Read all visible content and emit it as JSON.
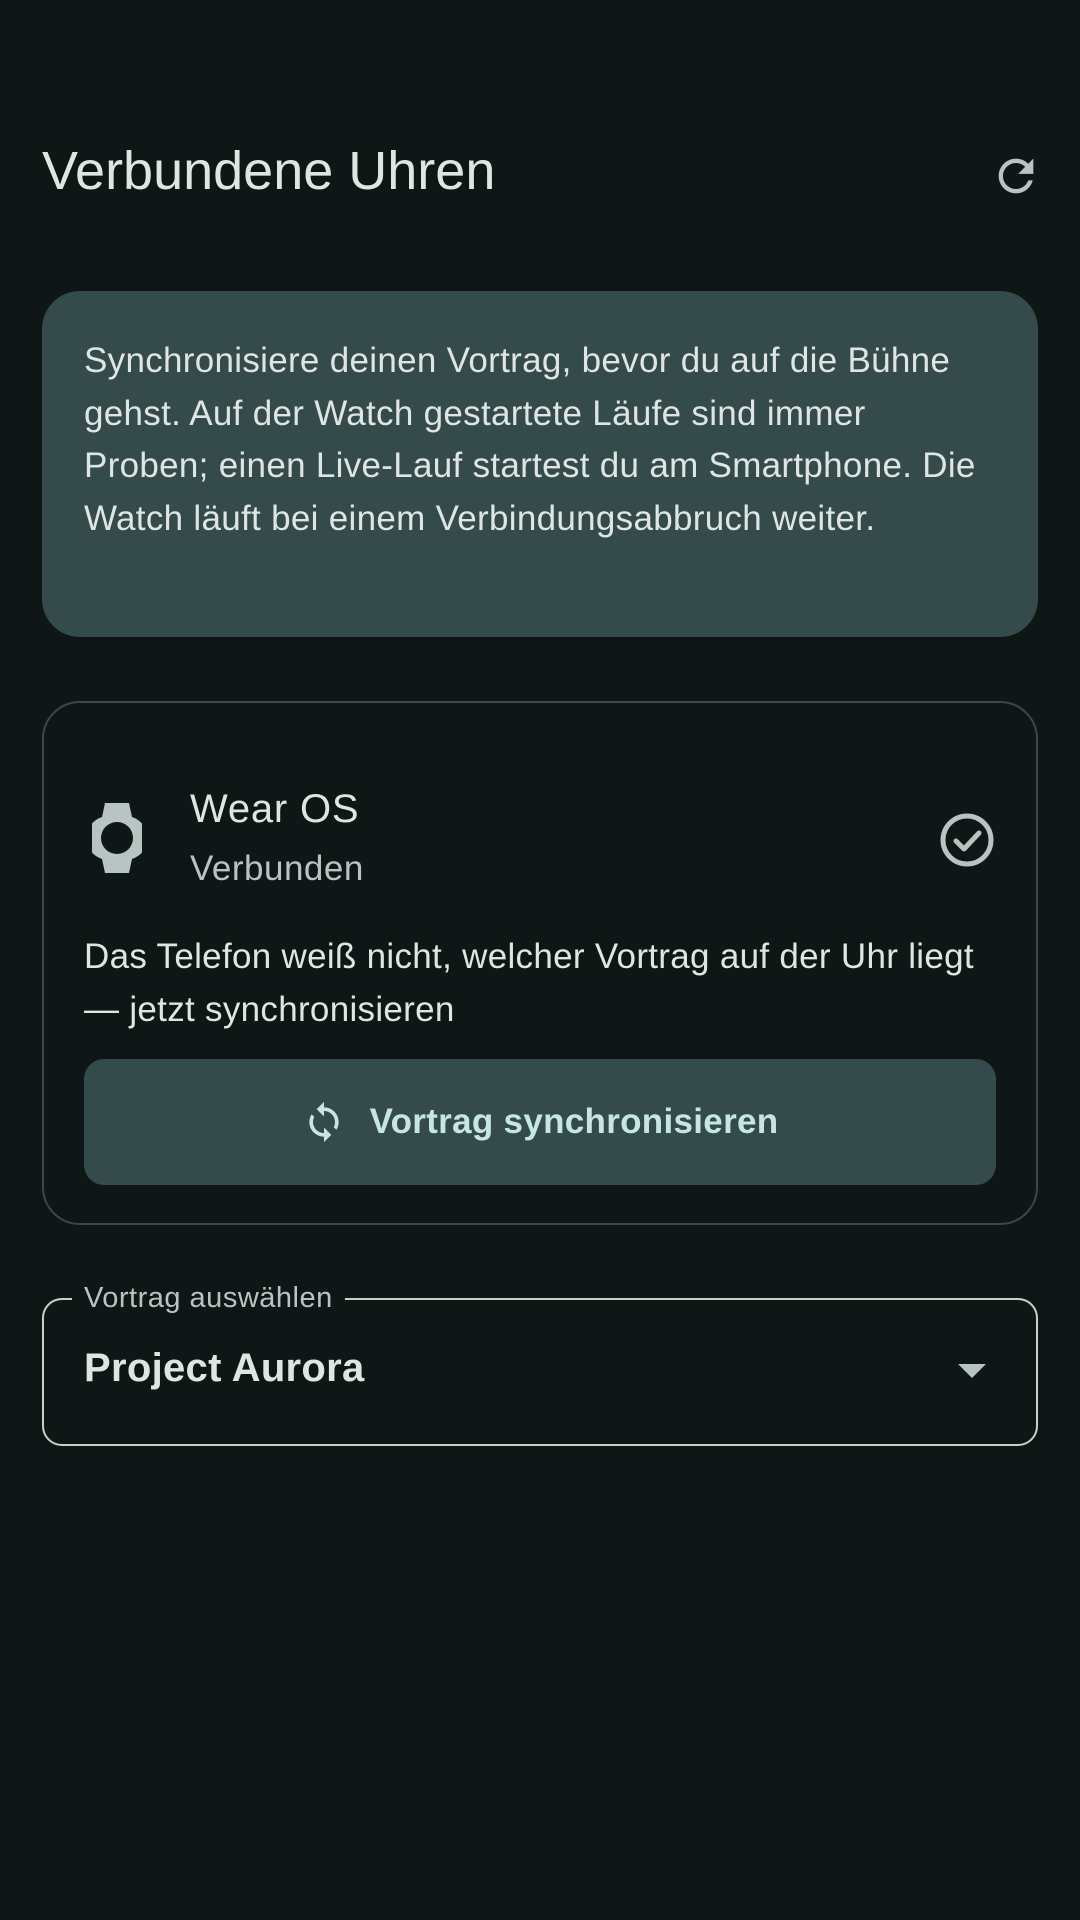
{
  "header": {
    "title": "Verbundene Uhren",
    "refresh_icon": "refresh-icon"
  },
  "info_card": {
    "text": "Synchronisiere deinen Vortrag, bevor du auf die Bühne gehst. Auf der Watch gestartete Läufe sind immer Proben; einen Live-Lauf startest du am Smartphone. Die Watch läuft bei einem Verbindungsabbruch weiter."
  },
  "watch": {
    "name": "Wear OS",
    "status": "Verbunden",
    "watch_icon": "watch-icon",
    "status_icon": "check-circle-icon",
    "hint": "Das Telefon weiß nicht, welcher Vortrag auf der Uhr liegt — jetzt synchronisieren",
    "sync_button_label": "Vortrag synchronisieren",
    "sync_icon": "sync-icon"
  },
  "talk_select": {
    "label": "Vortrag auswählen",
    "value": "Project Aurora",
    "dropdown_icon": "arrow-drop-down-icon"
  },
  "colors": {
    "background": "#0f1616",
    "card_tonal": "#344a4b",
    "text_primary": "#dfe5e3",
    "text_secondary": "#b8c4c1",
    "button_text": "#c6e6e4",
    "outline": "#3d4746"
  }
}
